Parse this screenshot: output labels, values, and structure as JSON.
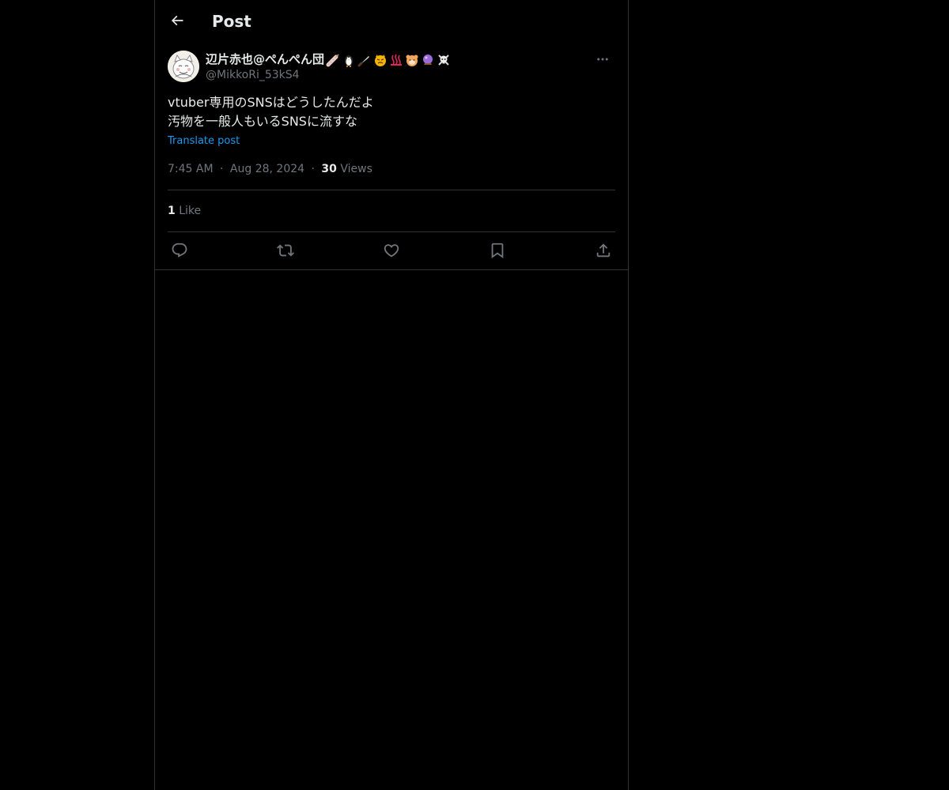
{
  "header": {
    "title": "Post"
  },
  "post": {
    "author": {
      "display_name": "辺片赤也@ぺんぺん団",
      "handle": "@MikkoRi_53kS4",
      "name_emojis": [
        "candy-icon",
        "penguin-icon",
        "knife-icon",
        "devil-face-icon",
        "hot-springs-icon",
        "hamster-icon",
        "crystal-ball-icon",
        "skull-crossbones-icon"
      ]
    },
    "text": "vtuber専用のSNSはどうしたんだよ\n汚物を一般人もいるSNSに流すな",
    "translate_label": "Translate post",
    "time": "7:45 AM",
    "date": "Aug 28, 2024",
    "separator": "·",
    "views_count": "30",
    "views_label": "Views",
    "likes_count": "1",
    "likes_label": "Like"
  },
  "actions": [
    "reply-icon",
    "repost-icon",
    "like-icon",
    "bookmark-icon",
    "share-icon"
  ],
  "colors": {
    "background": "#000000",
    "text": "#e7e9ea",
    "secondary": "#71767b",
    "link": "#1d9bf0",
    "border": "#2f3336"
  }
}
